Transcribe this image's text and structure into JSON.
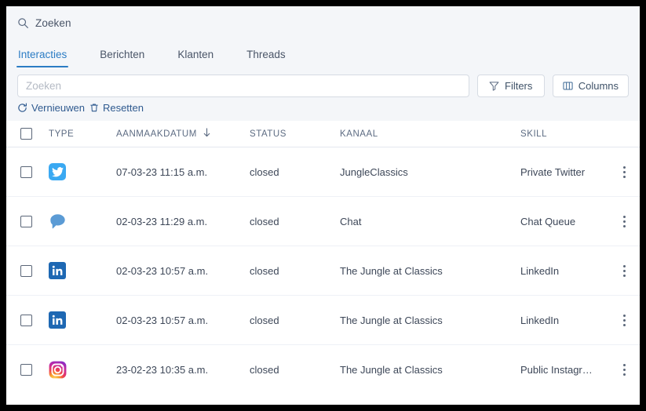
{
  "global_search": {
    "label": "Zoeken",
    "icon": "search-icon"
  },
  "tabs": [
    {
      "label": "Interacties",
      "active": true
    },
    {
      "label": "Berichten",
      "active": false
    },
    {
      "label": "Klanten",
      "active": false
    },
    {
      "label": "Threads",
      "active": false
    }
  ],
  "filter_bar": {
    "search_placeholder": "Zoeken",
    "search_value": "",
    "filters_label": "Filters",
    "filters_icon": "funnel-icon",
    "columns_label": "Columns",
    "columns_icon": "columns-icon"
  },
  "actions": {
    "refresh_label": "Vernieuwen",
    "refresh_icon": "refresh-icon",
    "reset_label": "Resetten",
    "reset_icon": "trash-icon"
  },
  "table": {
    "columns": [
      {
        "key": "type",
        "label": "TYPE"
      },
      {
        "key": "date",
        "label": "AANMAAKDATUM",
        "sort": "desc",
        "sort_icon": "arrow-down-icon"
      },
      {
        "key": "status",
        "label": "STATUS"
      },
      {
        "key": "channel",
        "label": "KANAAL"
      },
      {
        "key": "skill",
        "label": "SKILL"
      }
    ],
    "rows": [
      {
        "type_icon": "twitter-icon",
        "date": "07-03-23 11:15 a.m.",
        "status": "closed",
        "channel": "JungleClassics",
        "skill": "Private Twitter"
      },
      {
        "type_icon": "chat-bubble-icon",
        "date": "02-03-23 11:29 a.m.",
        "status": "closed",
        "channel": "Chat",
        "skill": "Chat Queue"
      },
      {
        "type_icon": "linkedin-icon",
        "date": "02-03-23 10:57 a.m.",
        "status": "closed",
        "channel": "The Jungle at Classics",
        "skill": "LinkedIn"
      },
      {
        "type_icon": "linkedin-icon",
        "date": "02-03-23 10:57 a.m.",
        "status": "closed",
        "channel": "The Jungle at Classics",
        "skill": "LinkedIn"
      },
      {
        "type_icon": "instagram-icon",
        "date": "23-02-23 10:35 a.m.",
        "status": "closed",
        "channel": "The Jungle at Classics",
        "skill": "Public Instagr…"
      }
    ]
  },
  "colors": {
    "accent": "#2b7cc4",
    "top_background": "#f4f6f9",
    "border": "#d6dbe3",
    "text": "#3d4758",
    "twitter": "#3aa9f2",
    "linkedin": "#1e68b3",
    "chat": "#5b9bd5"
  }
}
